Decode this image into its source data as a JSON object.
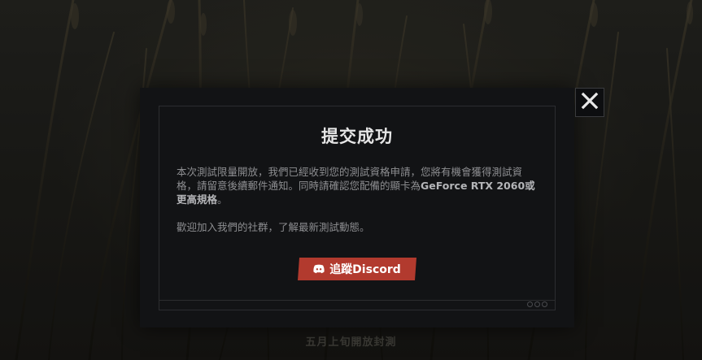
{
  "background": {
    "footer_hint": "五月上旬開放封測"
  },
  "modal": {
    "title": "提交成功",
    "body_line_1": "本次測試限量開放，我們已經收到您的測試資格申請，您將有機會獲得測試資格，請留意後續郵件通知。同時請確認您配備的顯卡為",
    "body_gpu": "GeForce RTX 2060",
    "body_line_1_suffix": "或更高規格",
    "body_line_1_end": "。",
    "body_line_2": "歡迎加入我們的社群，了解最新測試動態。",
    "discord_button_label": "追蹤Discord",
    "discord_icon": "discord-icon",
    "close_icon": "close-icon"
  },
  "colors": {
    "accent": "#b23a2e",
    "modal_bg": "#121315"
  }
}
